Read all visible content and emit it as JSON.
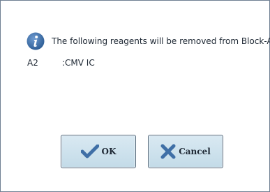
{
  "dialog": {
    "icon": "info-icon",
    "message": "The following reagents will be removed from Block-A.",
    "reagents": [
      {
        "well": "A2",
        "name": ":CMV IC"
      }
    ]
  },
  "buttons": {
    "ok": {
      "label": "OK",
      "icon": "checkmark-icon"
    },
    "cancel": {
      "label": "Cancel",
      "icon": "x-mark-icon"
    }
  },
  "colors": {
    "accent": "#3f6fa6",
    "button_bg": "#cfe3ee",
    "border": "#6f7f93"
  }
}
